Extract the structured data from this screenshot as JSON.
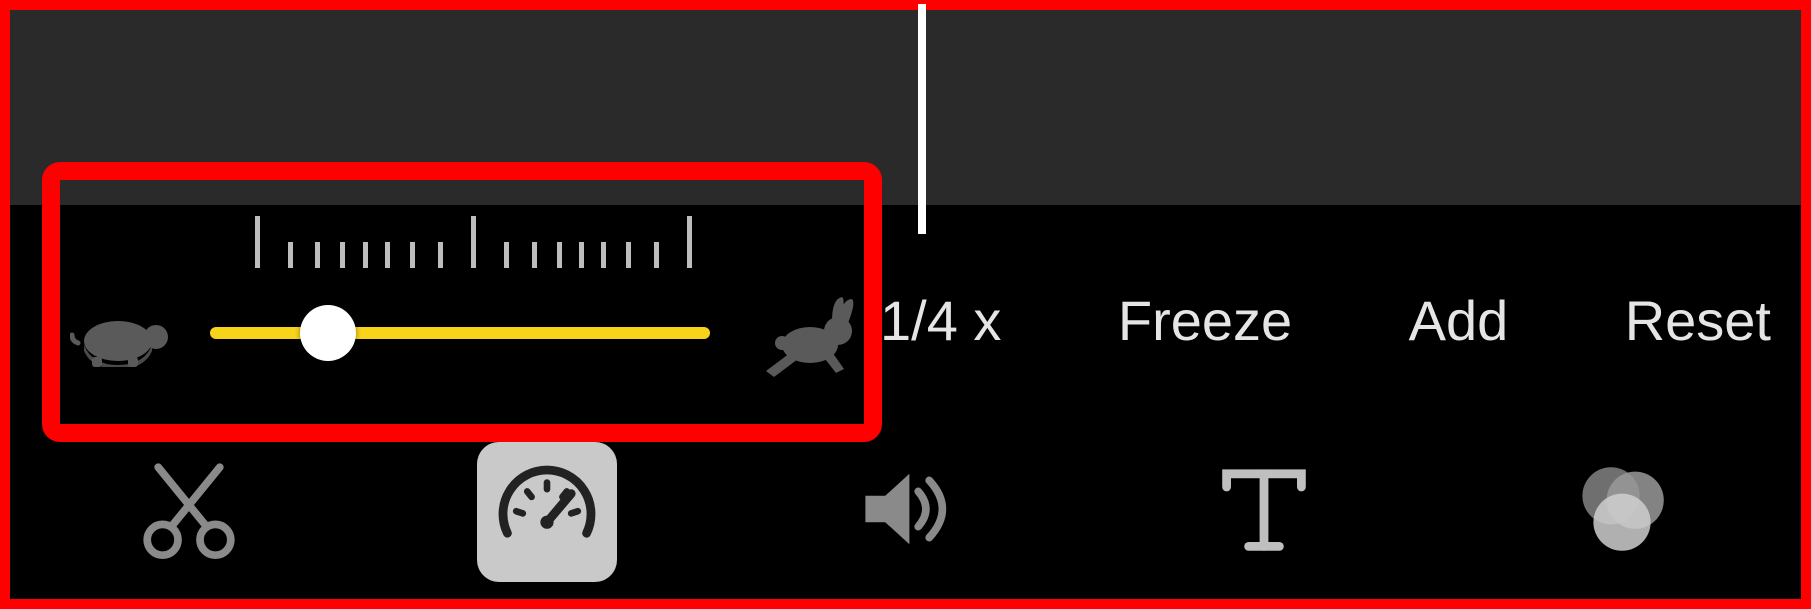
{
  "speed": {
    "slider_value": 0.22,
    "slow_icon": "turtle-icon",
    "fast_icon": "rabbit-icon",
    "option_label": "1/4 x",
    "freeze_label": "Freeze",
    "add_label": "Add",
    "reset_label": "Reset"
  },
  "toolbar": {
    "cut": "cut-icon",
    "speed": "speedometer-icon",
    "volume": "volume-icon",
    "text": "text-icon",
    "filters": "filters-icon",
    "selected": "speed"
  },
  "colors": {
    "accent": "#f7d31a",
    "highlight": "#ff0000",
    "bg": "#000000",
    "preview": "#2a2a2a",
    "text": "#e5e5e5"
  }
}
